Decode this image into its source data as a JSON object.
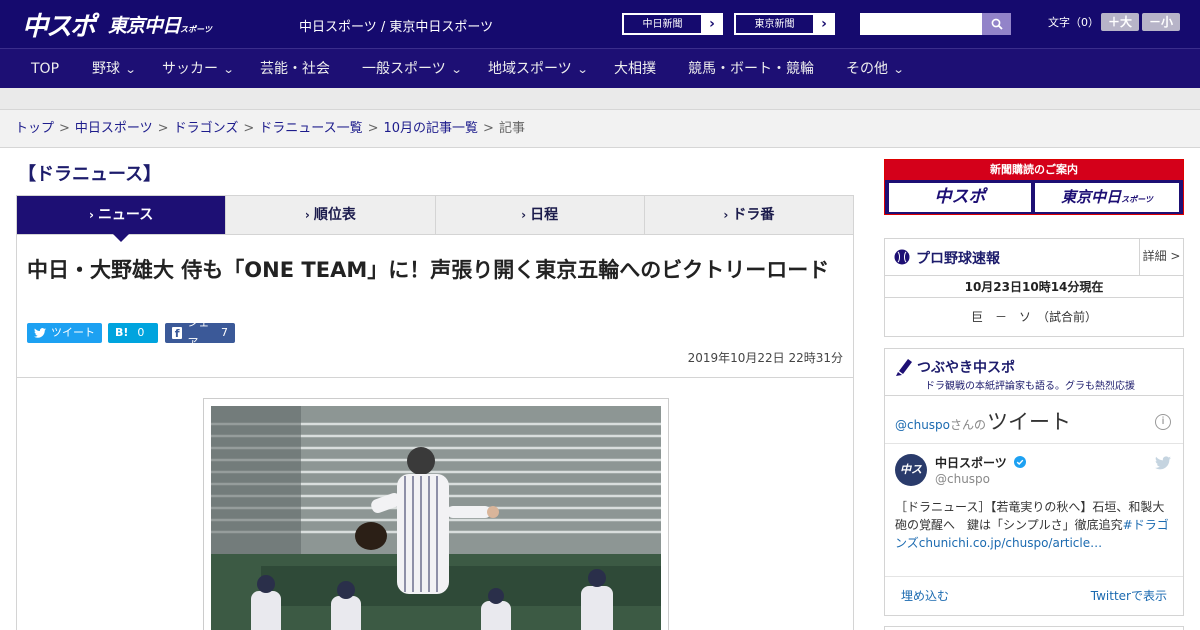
{
  "header": {
    "logo_main": "中スポ",
    "logo_sub": "東京中日",
    "logo_sub_small": "スポーツ",
    "site_title": "中日スポーツ / 東京中日スポーツ",
    "paper_links": [
      {
        "label": "中日新聞",
        "arrow": "›"
      },
      {
        "label": "東京新聞",
        "arrow": "›"
      }
    ],
    "search_placeholder": "",
    "font_size_label": "文字（0）",
    "font_plus": "＋大",
    "font_minus": "－小"
  },
  "nav": {
    "items": [
      {
        "label": "TOP",
        "chevron": ""
      },
      {
        "label": "野球",
        "chevron": "⌄"
      },
      {
        "label": "サッカー",
        "chevron": "⌄"
      },
      {
        "label": "芸能・社会",
        "chevron": ""
      },
      {
        "label": "一般スポーツ",
        "chevron": "⌄"
      },
      {
        "label": "地域スポーツ",
        "chevron": "⌄"
      },
      {
        "label": "大相撲",
        "chevron": ""
      },
      {
        "label": "競馬・ボート・競輪",
        "chevron": ""
      },
      {
        "label": "その他",
        "chevron": "⌄"
      }
    ]
  },
  "breadcrumb": {
    "items": [
      "トップ",
      "中日スポーツ",
      "ドラゴンズ",
      "ドラニュース一覧",
      "10月の記事一覧"
    ],
    "current": "記事",
    "separator": ">"
  },
  "main": {
    "section_title": "【ドラニュース】",
    "tabs": [
      {
        "label": "ニュース",
        "active": true
      },
      {
        "label": "順位表",
        "active": false
      },
      {
        "label": "日程",
        "active": false
      },
      {
        "label": "ドラ番",
        "active": false
      }
    ],
    "tab_chevron": "›",
    "headline": "中日・大野雄大 侍も「ONE TEAM」に！声張り開く東京五輪へのビクトリーロード",
    "share": {
      "tweet_label": "ツイート",
      "hatena_label": "B!",
      "hatena_count": "0",
      "facebook_label": "シェア",
      "facebook_count": "7"
    },
    "date": "2019年10月22日 22時31分",
    "colors": {
      "nav_bg": "#1d0f74",
      "header_bg": "#150a6e",
      "accent_red": "#d4001a"
    }
  },
  "sidebar": {
    "banner_title": "新聞購読のご案内",
    "banner_left": "中スポ",
    "banner_right": "東京中日",
    "banner_right_small": "スポーツ",
    "score": {
      "title": "プロ野球速報",
      "detail": "詳細 >",
      "time": "10月23日10時14分現在",
      "game": "巨　－　ソ　（試合前）"
    },
    "twitter": {
      "title": "つぶやき中スポ",
      "subtitle": "ドラ観戦の本紙評論家も語る。グラも熱烈応援",
      "handle_link": "@chuspo",
      "san": "さんの",
      "tweet_word": "ツイート",
      "info": "i",
      "avatar_text": "中スポ",
      "name": "中日スポーツ",
      "handle": "@chuspo",
      "text_main": "［ドラニュース］【若竜実りの秋へ】石垣、和製大砲の覚醒へ　鍵は「シンプルさ」徹底追究",
      "text_tag": "#ドラゴンズ",
      "text_link": "chunichi.co.jp/chuspo/article…",
      "embed": "埋め込む",
      "view_on": "Twitterで表示"
    }
  }
}
